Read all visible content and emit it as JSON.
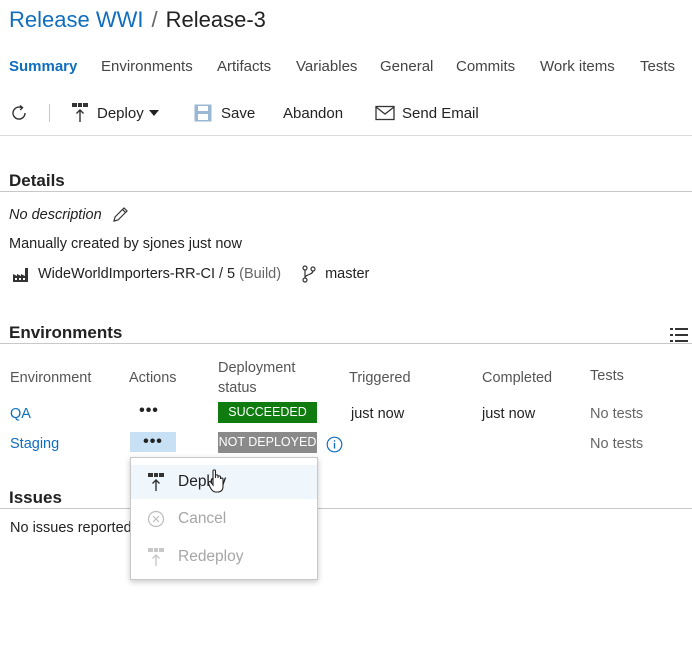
{
  "header": {
    "pipeline": "Release WWI",
    "separator": "/",
    "release": "Release-3"
  },
  "tabs": [
    {
      "label": "Summary",
      "active": true
    },
    {
      "label": "Environments"
    },
    {
      "label": "Artifacts"
    },
    {
      "label": "Variables"
    },
    {
      "label": "General"
    },
    {
      "label": "Commits"
    },
    {
      "label": "Work items"
    },
    {
      "label": "Tests"
    }
  ],
  "toolbar": {
    "refresh_icon": "refresh-icon",
    "deploy_label": "Deploy",
    "save_label": "Save",
    "abandon_label": "Abandon",
    "send_email_label": "Send Email"
  },
  "details": {
    "title": "Details",
    "description": "No description",
    "created": "Manually created by sjones just now",
    "artifact": "WideWorldImporters-RR-CI / 5",
    "artifact_type": "(Build)",
    "branch": "master"
  },
  "environments": {
    "title": "Environments",
    "columns": {
      "environment": "Environment",
      "actions": "Actions",
      "status_line1": "Deployment",
      "status_line2": "status",
      "triggered": "Triggered",
      "completed": "Completed",
      "tests": "Tests"
    },
    "rows": [
      {
        "name": "QA",
        "actions": "•••",
        "status": "SUCCEEDED",
        "triggered": "just now",
        "completed": "just now",
        "tests": "No tests"
      },
      {
        "name": "Staging",
        "actions": "•••",
        "status": "NOT DEPLOYED",
        "triggered": "",
        "completed": "",
        "tests": "No tests"
      }
    ]
  },
  "issues": {
    "title": "Issues",
    "text": "No issues reported"
  },
  "menu": {
    "items": [
      {
        "label": "Deploy",
        "enabled": true
      },
      {
        "label": "Cancel",
        "enabled": false
      },
      {
        "label": "Redeploy",
        "enabled": false
      }
    ]
  },
  "colors": {
    "accent": "#106ebe",
    "succeeded": "#107c10",
    "not_deployed": "#8a8a8a"
  }
}
